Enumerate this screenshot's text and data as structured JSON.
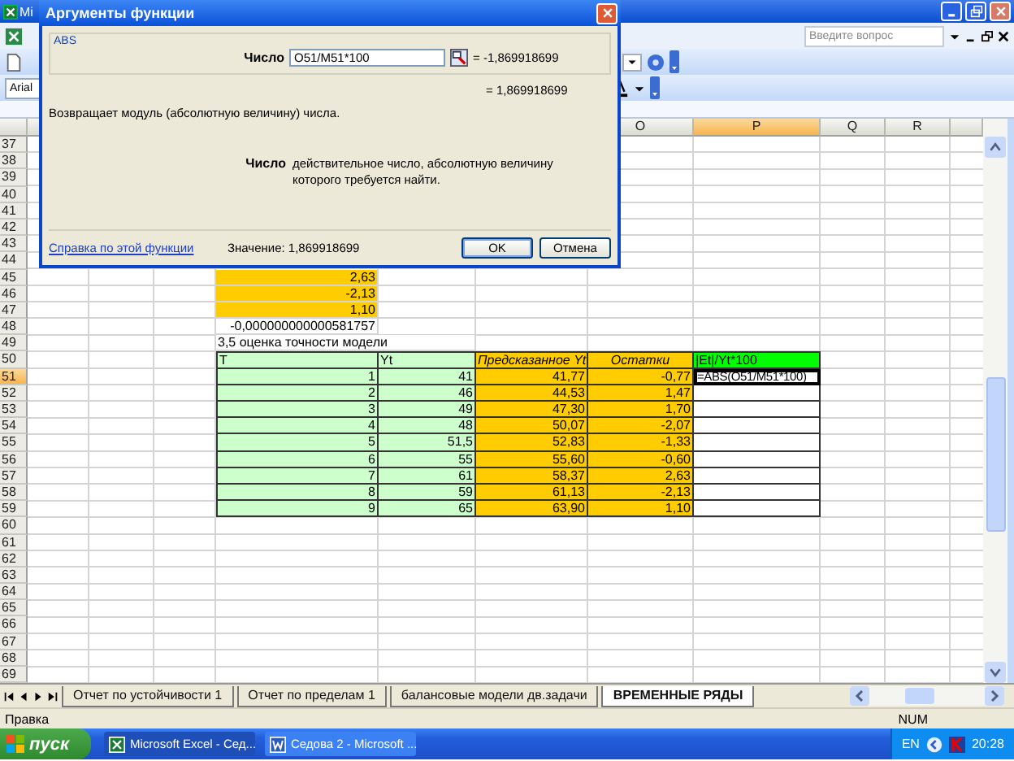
{
  "app_window": {
    "title": "Mi"
  },
  "help_search": {
    "placeholder": "Введите вопрос"
  },
  "font_field": {
    "value": "Arial"
  },
  "dialog": {
    "title": "Аргументы функции",
    "function": "ABS",
    "argument": {
      "label": "Число",
      "value": "O51/M51*100",
      "result": "= -1,869918699"
    },
    "result": "= 1,869918699",
    "description": "Возвращает модуль (абсолютную величину) числа.",
    "argument_help": {
      "label": "Число",
      "text": "действительное число, абсолютную величину которого требуется найти."
    },
    "help_link": "Справка по этой функции",
    "value_text": "Значение: 1,869918699",
    "buttons": [
      {
        "label": "OK",
        "kind": "default"
      },
      {
        "label": "Отмена",
        "kind": "normal"
      }
    ]
  },
  "column_headers": [
    {
      "label": "O",
      "selected": false
    },
    {
      "label": "P",
      "selected": true
    },
    {
      "label": "Q",
      "selected": false
    },
    {
      "label": "R",
      "selected": false
    }
  ],
  "rows": [
    {
      "label": "37",
      "selected": false
    },
    {
      "label": "38",
      "selected": false
    },
    {
      "label": "39",
      "selected": false
    },
    {
      "label": "40",
      "selected": false
    },
    {
      "label": "41",
      "selected": false
    },
    {
      "label": "42",
      "selected": false
    },
    {
      "label": "43",
      "selected": false
    },
    {
      "label": "44",
      "selected": false
    },
    {
      "label": "45",
      "selected": false,
      "cells": [
        {
          "text": "2,63",
          "kind": "number",
          "color": "#ffcc00"
        }
      ]
    },
    {
      "label": "46",
      "selected": false,
      "cells": [
        {
          "text": "-2,13",
          "kind": "number",
          "color": "#ffcc00"
        }
      ]
    },
    {
      "label": "47",
      "selected": false,
      "cells": [
        {
          "text": "1,10",
          "kind": "number",
          "color": "#ffcc00"
        }
      ]
    },
    {
      "label": "48",
      "selected": false,
      "cells": [
        {
          "text": "-0,000000000000581757",
          "kind": "number",
          "color": "#ffffff"
        }
      ]
    },
    {
      "label": "49",
      "selected": false,
      "cells": [
        {
          "text": "3,5 оценка точности модели",
          "kind": "caption",
          "color": "#ffffff"
        }
      ]
    },
    {
      "label": "50",
      "selected": false,
      "cells": [
        {
          "text": "T",
          "kind": "header",
          "color": "#ccffcc"
        },
        {
          "text": "Yt",
          "kind": "header",
          "color": "#ccffcc"
        },
        {
          "text": "Предсказанное Yt",
          "kind": "header-italic",
          "color": "#ffcc00"
        },
        {
          "text": "Остатки",
          "kind": "header-italic-center",
          "color": "#ffcc00"
        },
        {
          "text": "|Et|/Yt*100",
          "kind": "header",
          "color": "#00ff00"
        }
      ]
    },
    {
      "label": "51",
      "selected": true,
      "cells": [
        {
          "text": "1",
          "kind": "table-number",
          "color": "#ccffcc"
        },
        {
          "text": "41",
          "kind": "table-number",
          "color": "#ccffcc"
        },
        {
          "text": "41,77",
          "kind": "table-number",
          "color": "#ffcc00"
        },
        {
          "text": "-0,77",
          "kind": "table-number",
          "color": "#ffcc00"
        },
        {
          "text": "=ABS(O51/M51*100)",
          "kind": "editing",
          "color": "#ffffff"
        }
      ]
    },
    {
      "label": "52",
      "selected": false,
      "cells": [
        {
          "text": "2",
          "kind": "table-number",
          "color": "#ccffcc"
        },
        {
          "text": "46",
          "kind": "table-number",
          "color": "#ccffcc"
        },
        {
          "text": "44,53",
          "kind": "table-number",
          "color": "#ffcc00"
        },
        {
          "text": "1,47",
          "kind": "table-number",
          "color": "#ffcc00"
        },
        {
          "kind": "table-empty",
          "color": "#ffffff"
        }
      ]
    },
    {
      "label": "53",
      "selected": false,
      "cells": [
        {
          "text": "3",
          "kind": "table-number",
          "color": "#ccffcc"
        },
        {
          "text": "49",
          "kind": "table-number",
          "color": "#ccffcc"
        },
        {
          "text": "47,30",
          "kind": "table-number",
          "color": "#ffcc00"
        },
        {
          "text": "1,70",
          "kind": "table-number",
          "color": "#ffcc00"
        },
        {
          "kind": "table-empty",
          "color": "#ffffff"
        }
      ]
    },
    {
      "label": "54",
      "selected": false,
      "cells": [
        {
          "text": "4",
          "kind": "table-number",
          "color": "#ccffcc"
        },
        {
          "text": "48",
          "kind": "table-number",
          "color": "#ccffcc"
        },
        {
          "text": "50,07",
          "kind": "table-number",
          "color": "#ffcc00"
        },
        {
          "text": "-2,07",
          "kind": "table-number",
          "color": "#ffcc00"
        },
        {
          "kind": "table-empty",
          "color": "#ffffff"
        }
      ]
    },
    {
      "label": "55",
      "selected": false,
      "cells": [
        {
          "text": "5",
          "kind": "table-number",
          "color": "#ccffcc"
        },
        {
          "text": "51,5",
          "kind": "table-number",
          "color": "#ccffcc"
        },
        {
          "text": "52,83",
          "kind": "table-number",
          "color": "#ffcc00"
        },
        {
          "text": "-1,33",
          "kind": "table-number",
          "color": "#ffcc00"
        },
        {
          "kind": "table-empty",
          "color": "#ffffff"
        }
      ]
    },
    {
      "label": "56",
      "selected": false,
      "cells": [
        {
          "text": "6",
          "kind": "table-number",
          "color": "#ccffcc"
        },
        {
          "text": "55",
          "kind": "table-number",
          "color": "#ccffcc"
        },
        {
          "text": "55,60",
          "kind": "table-number",
          "color": "#ffcc00"
        },
        {
          "text": "-0,60",
          "kind": "table-number",
          "color": "#ffcc00"
        },
        {
          "kind": "table-empty",
          "color": "#ffffff"
        }
      ]
    },
    {
      "label": "57",
      "selected": false,
      "cells": [
        {
          "text": "7",
          "kind": "table-number",
          "color": "#ccffcc"
        },
        {
          "text": "61",
          "kind": "table-number",
          "color": "#ccffcc"
        },
        {
          "text": "58,37",
          "kind": "table-number",
          "color": "#ffcc00"
        },
        {
          "text": "2,63",
          "kind": "table-number",
          "color": "#ffcc00"
        },
        {
          "kind": "table-empty",
          "color": "#ffffff"
        }
      ]
    },
    {
      "label": "58",
      "selected": false,
      "cells": [
        {
          "text": "8",
          "kind": "table-number",
          "color": "#ccffcc"
        },
        {
          "text": "59",
          "kind": "table-number",
          "color": "#ccffcc"
        },
        {
          "text": "61,13",
          "kind": "table-number",
          "color": "#ffcc00"
        },
        {
          "text": "-2,13",
          "kind": "table-number",
          "color": "#ffcc00"
        },
        {
          "kind": "table-empty",
          "color": "#ffffff"
        }
      ]
    },
    {
      "label": "59",
      "selected": false,
      "cells": [
        {
          "text": "9",
          "kind": "table-number",
          "color": "#ccffcc"
        },
        {
          "text": "65",
          "kind": "table-number",
          "color": "#ccffcc"
        },
        {
          "text": "63,90",
          "kind": "table-number",
          "color": "#ffcc00"
        },
        {
          "text": "1,10",
          "kind": "table-number",
          "color": "#ffcc00"
        },
        {
          "kind": "table-empty",
          "color": "#ffffff"
        }
      ]
    },
    {
      "label": "60",
      "selected": false
    },
    {
      "label": "61",
      "selected": false
    },
    {
      "label": "62",
      "selected": false
    },
    {
      "label": "63",
      "selected": false
    },
    {
      "label": "64",
      "selected": false
    },
    {
      "label": "65",
      "selected": false
    },
    {
      "label": "66",
      "selected": false
    },
    {
      "label": "67",
      "selected": false
    },
    {
      "label": "68",
      "selected": false
    },
    {
      "label": "69",
      "selected": false
    }
  ],
  "sheet_tabs": [
    {
      "label": "Отчет по устойчивости 1",
      "selected": false
    },
    {
      "label": "Отчет по пределам 1",
      "selected": false
    },
    {
      "label": "балансовые модели дв.задачи",
      "selected": false
    },
    {
      "label": "ВРЕМЕННЫЕ РЯДЫ",
      "selected": true
    }
  ],
  "status_bar": {
    "mode": "Правка",
    "indicator": "NUM"
  },
  "taskbar": {
    "start": "пуск",
    "tasks": [
      {
        "label": "Microsoft Excel - Сед...",
        "selected": true,
        "kind": "excel"
      },
      {
        "label": "Седова 2 - Microsoft ...",
        "selected": false,
        "kind": "word"
      }
    ],
    "language": "EN",
    "clock": "20:28"
  }
}
